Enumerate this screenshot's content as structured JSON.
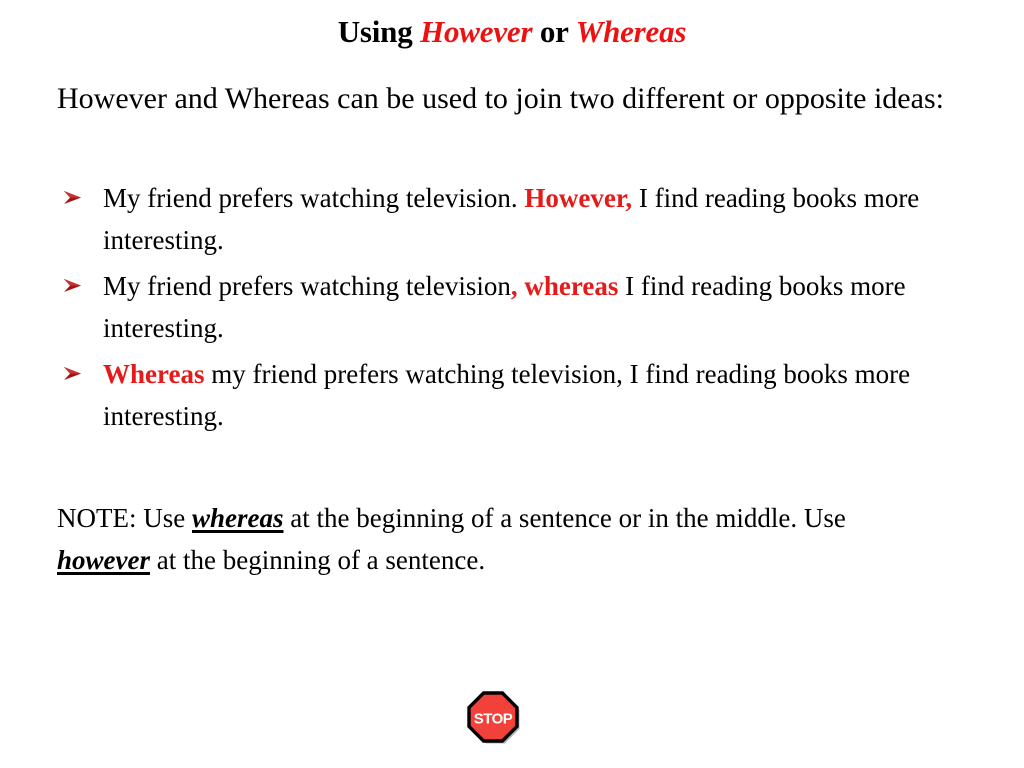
{
  "slide": {
    "background_color": "#FFFFFF",
    "accent_red": "#EE1111",
    "text_color": "#000000"
  },
  "title": {
    "part1": "Using ",
    "emph1": "However",
    "part2": " or ",
    "emph2": "Whereas"
  },
  "intro": {
    "text": "However and Whereas can be used to join two different or opposite ideas:"
  },
  "bullets": {
    "marker_icon": "arrowhead-bullet-icon",
    "items": [
      {
        "pre": "My friend prefers watching television. ",
        "highlight": "However,",
        "post": " I find reading books more interesting."
      },
      {
        "pre": "My friend prefers watching television",
        "highlight": ", whereas",
        "post": " I find reading books more interesting."
      },
      {
        "pre": "",
        "highlight": "Whereas",
        "post": " my friend prefers watching television, I find reading books more interesting."
      }
    ]
  },
  "note": {
    "part1": "NOTE: Use ",
    "emph1": "whereas",
    "part2": " at the beginning of a sentence or in the middle. Use ",
    "emph2": "however",
    "part3": " at the beginning of a sentence."
  },
  "stop_sign": {
    "icon": "stop-sign-icon",
    "label": "STOP",
    "fill_color": "#F2403A",
    "border_color": "#000000",
    "text_color": "#FFFFFF"
  }
}
